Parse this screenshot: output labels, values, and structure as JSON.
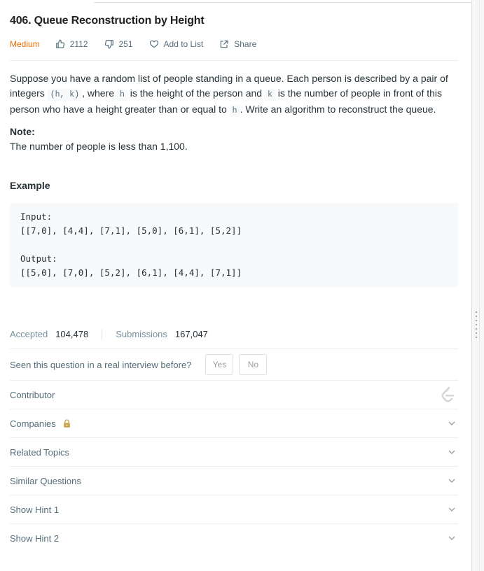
{
  "problem": {
    "title": "406. Queue Reconstruction by Height",
    "difficulty": "Medium",
    "likes": "2112",
    "dislikes": "251",
    "add_to_list": "Add to List",
    "share": "Share"
  },
  "description": {
    "p1_a": "Suppose you have a random list of people standing in a queue. Each person is described by a pair of integers ",
    "code_hk": "(h, k)",
    "p1_b": ", where ",
    "code_h": "h",
    "p1_c": " is the height of the person and ",
    "code_k": "k",
    "p1_d": " is the number of people in front of this person who have a height greater than or equal to ",
    "code_h2": "h",
    "p1_e": ". Write an algorithm to reconstruct the queue.",
    "note_heading": "Note:",
    "note_text": "The number of people is less than 1,100."
  },
  "example": {
    "heading": "Example",
    "input_label": "Input:",
    "input_value": "[[7,0], [4,4], [7,1], [5,0], [6,1], [5,2]]",
    "output_label": "Output:",
    "output_value": "[[5,0], [7,0], [5,2], [6,1], [4,4], [7,1]]"
  },
  "stats": {
    "accepted_label": "Accepted",
    "accepted_value": "104,478",
    "submissions_label": "Submissions",
    "submissions_value": "167,047"
  },
  "interview": {
    "question": "Seen this question in a real interview before?",
    "yes": "Yes",
    "no": "No"
  },
  "sections": {
    "contributor": "Contributor",
    "companies": "Companies",
    "related_topics": "Related Topics",
    "similar_questions": "Similar Questions",
    "hint1": "Show Hint 1",
    "hint2": "Show Hint 2"
  },
  "colors": {
    "difficulty_medium": "#ef6c00",
    "lock": "#c9a64c",
    "muted_text": "#546e7a"
  },
  "icons": [
    "thumbs-up-icon",
    "thumbs-down-icon",
    "heart-icon",
    "share-icon",
    "leetcode-logo-icon",
    "lock-icon",
    "chevron-down-icon"
  ]
}
